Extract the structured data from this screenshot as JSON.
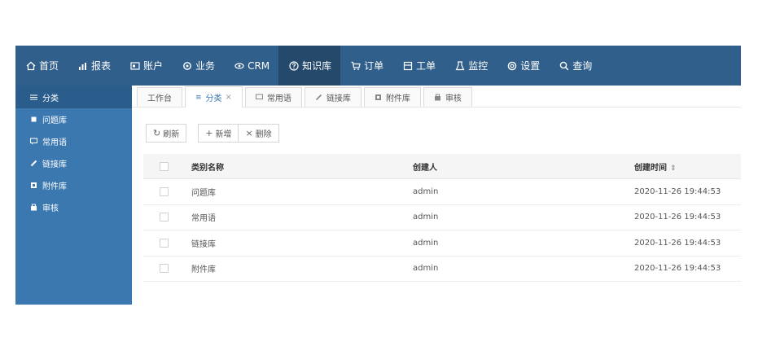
{
  "nav": {
    "items": [
      {
        "label": "首页",
        "icon": "home-icon"
      },
      {
        "label": "报表",
        "icon": "chart-icon"
      },
      {
        "label": "账户",
        "icon": "account-icon"
      },
      {
        "label": "业务",
        "icon": "business-icon"
      },
      {
        "label": "CRM",
        "icon": "crm-icon"
      },
      {
        "label": "知识库",
        "icon": "help-circle-icon",
        "active": true
      },
      {
        "label": "订单",
        "icon": "cart-icon"
      },
      {
        "label": "工单",
        "icon": "ticket-icon"
      },
      {
        "label": "监控",
        "icon": "monitor-icon"
      },
      {
        "label": "设置",
        "icon": "settings-icon"
      },
      {
        "label": "查询",
        "icon": "search-icon"
      }
    ]
  },
  "sidebar": {
    "items": [
      {
        "label": "分类",
        "icon": "list-icon",
        "active": true
      },
      {
        "label": "问题库",
        "icon": "square-icon"
      },
      {
        "label": "常用语",
        "icon": "message-icon"
      },
      {
        "label": "链接库",
        "icon": "link-icon"
      },
      {
        "label": "附件库",
        "icon": "attachment-icon"
      },
      {
        "label": "审核",
        "icon": "audit-icon"
      }
    ]
  },
  "tabs": [
    {
      "label": "工作台"
    },
    {
      "label": "分类",
      "active": true,
      "closable": true
    },
    {
      "label": "常用语"
    },
    {
      "label": "链接库"
    },
    {
      "label": "附件库"
    },
    {
      "label": "审核"
    }
  ],
  "toolbar": {
    "refresh_label": "刷新",
    "add_label": "新增",
    "delete_label": "删除"
  },
  "table": {
    "headers": {
      "name": "类别名称",
      "creator": "创建人",
      "time": "创建时间"
    },
    "rows": [
      {
        "name": "问题库",
        "creator": "admin",
        "time": "2020-11-26 19:44:53"
      },
      {
        "name": "常用语",
        "creator": "admin",
        "time": "2020-11-26 19:44:53"
      },
      {
        "name": "链接库",
        "creator": "admin",
        "time": "2020-11-26 19:44:53"
      },
      {
        "name": "附件库",
        "creator": "admin",
        "time": "2020-11-26 19:44:53"
      }
    ]
  },
  "colors": {
    "topbar": "#2f5f8a",
    "sidebar": "#3c78b0",
    "accent": "#3c78b0"
  }
}
